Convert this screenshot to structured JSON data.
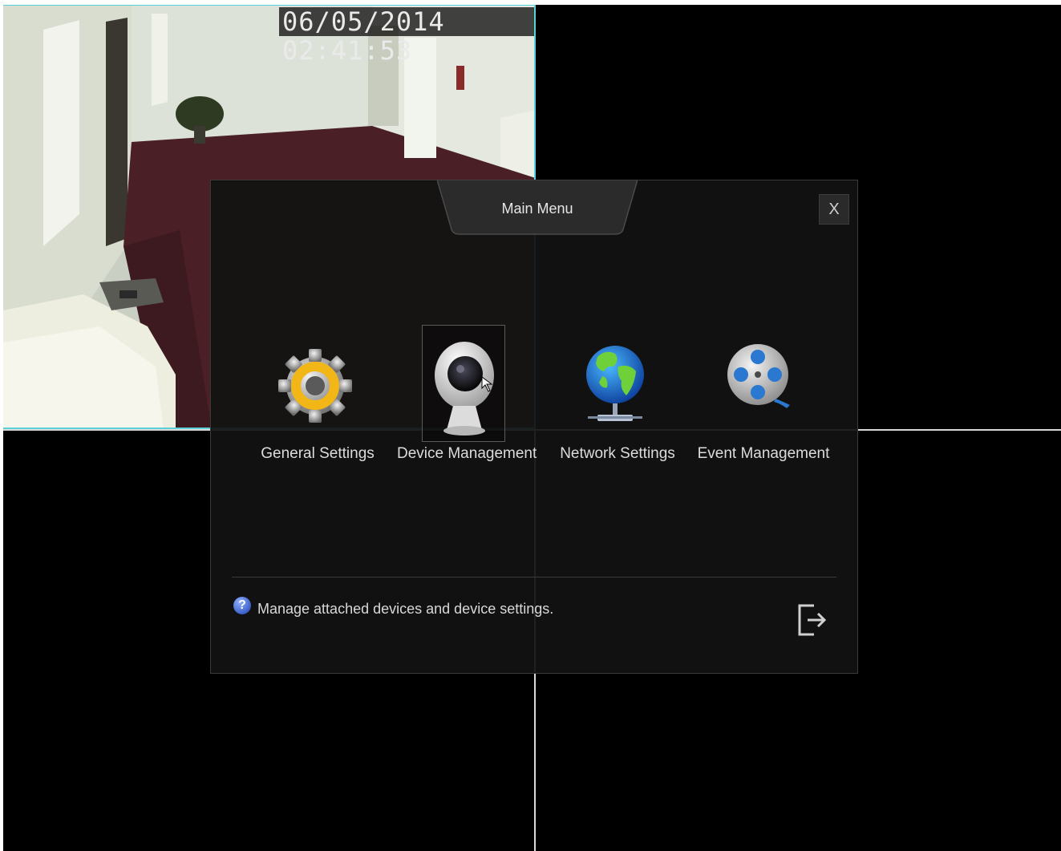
{
  "camera": {
    "timestamp": "06/05/2014 02:41:53"
  },
  "dialog": {
    "title": "Main Menu",
    "close_label": "X",
    "items": [
      {
        "label": "General Settings",
        "icon": "gear-icon"
      },
      {
        "label": "Device Management",
        "icon": "webcam-icon",
        "selected": true
      },
      {
        "label": "Network Settings",
        "icon": "globe-network-icon"
      },
      {
        "label": "Event Management",
        "icon": "film-reel-icon"
      }
    ],
    "help_icon_glyph": "?",
    "help_text": "Manage attached devices and device settings.",
    "logout_icon": "logout-icon"
  },
  "colors": {
    "highlight_border": "#5ad0d8",
    "dialog_bg": "#121212",
    "text": "#dcdcdc"
  }
}
